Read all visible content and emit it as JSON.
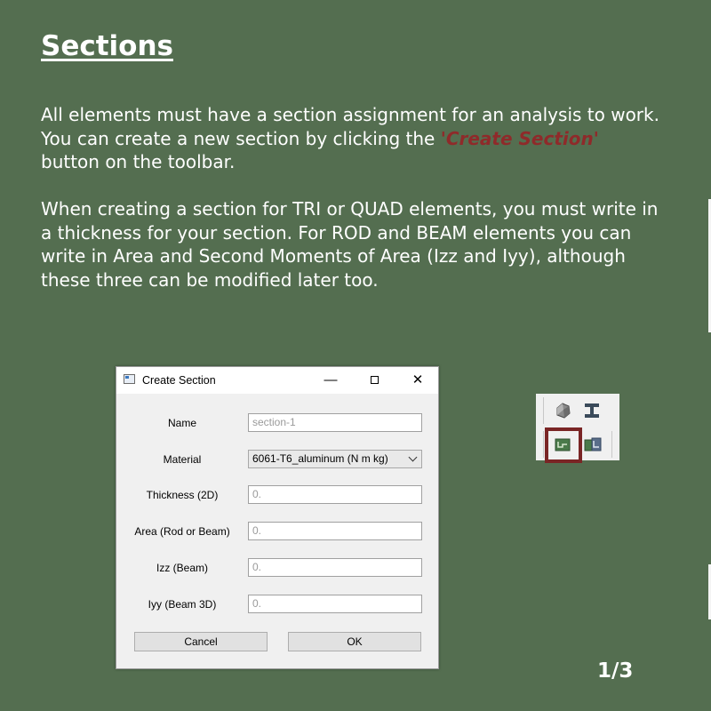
{
  "slide": {
    "title": "Sections",
    "para1_before": "All elements must have a section assignment for an analysis to work. You can create a new section by clicking the ",
    "para1_highlight": "'Create Section'",
    "para1_after": " button on the toolbar.",
    "para2": "When creating a section for TRI or QUAD elements, you must write in a thickness for your section. For ROD and BEAM elements you can write in Area and Second Moments of Area (Izz and Iyy), although these three can be modified later too.",
    "page_indicator": "1/3"
  },
  "colors": {
    "background": "#546e50",
    "highlight": "#8f2a2a",
    "highlight_box": "#7a2525"
  },
  "dialog": {
    "title": "Create Section",
    "window_icon": "app-window-icon",
    "minimize_glyph": "—",
    "close_glyph": "✕",
    "fields": {
      "name": {
        "label": "Name",
        "placeholder": "section-1"
      },
      "material": {
        "label": "Material",
        "selected": "6061-T6_aluminum (N m kg)"
      },
      "thickness": {
        "label": "Thickness (2D)",
        "placeholder": "0."
      },
      "area": {
        "label": "Area (Rod or Beam)",
        "placeholder": "0."
      },
      "izz": {
        "label": "Izz (Beam)",
        "placeholder": "0."
      },
      "iyy": {
        "label": "Iyy (Beam 3D)",
        "placeholder": "0."
      }
    },
    "buttons": {
      "cancel": "Cancel",
      "ok": "OK"
    }
  },
  "toolbar": {
    "icons": [
      "create-material-icon",
      "create-beam-section-icon",
      "create-section-icon",
      "assign-section-icon"
    ]
  }
}
